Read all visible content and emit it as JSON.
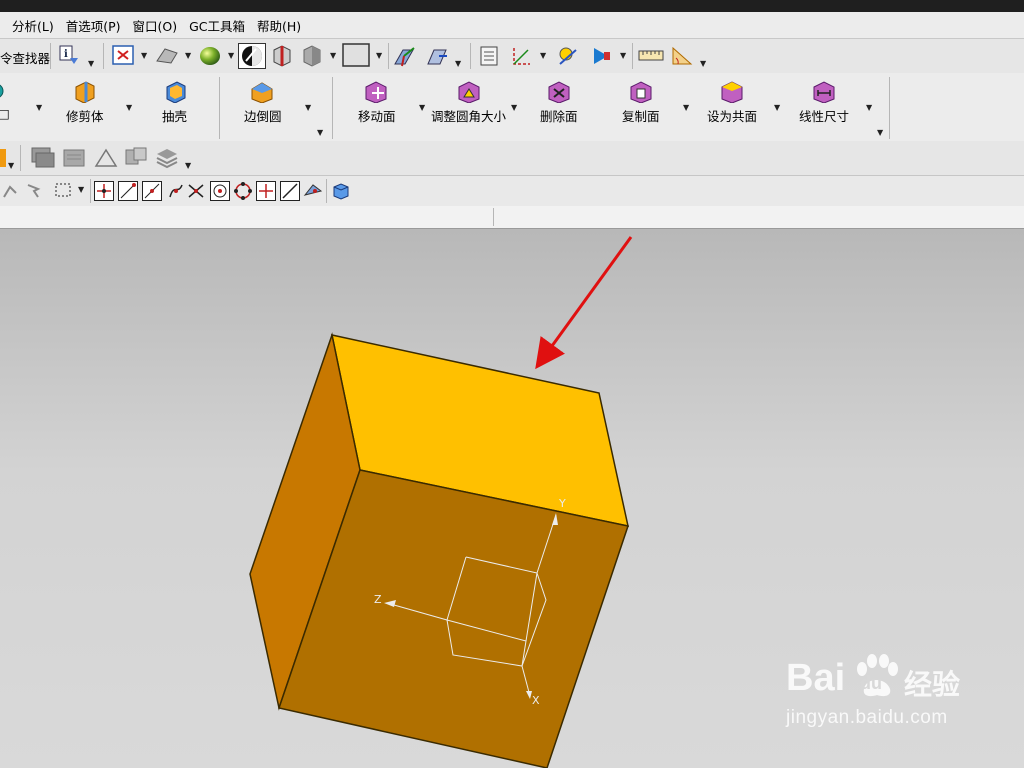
{
  "menu": {
    "items": [
      "分析(L)",
      "首选项(P)",
      "窗口(O)",
      "GC工具箱",
      "帮助(H)"
    ]
  },
  "toolbar1": {
    "command_finder_label": "令查找器"
  },
  "feature_toolbar": {
    "buttons": [
      "修剪体",
      "抽壳",
      "边倒圆",
      "移动面",
      "调整圆角大小",
      "删除面",
      "复制面",
      "设为共面",
      "线性尺寸"
    ]
  },
  "model": {
    "axis_labels": {
      "x": "X",
      "y": "Y",
      "z": "Z"
    },
    "colors": {
      "top": "#ffc000",
      "left": "#c87800",
      "front": "#b07000",
      "arrow": "#e01010"
    }
  },
  "watermark": {
    "brand_left": "Bai",
    "brand_right": "du",
    "brand_cn": "经验",
    "url": "jingyan.baidu.com"
  }
}
